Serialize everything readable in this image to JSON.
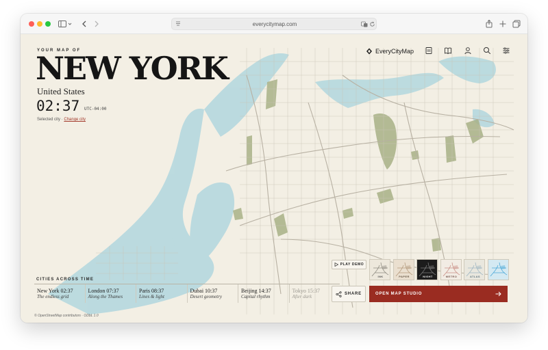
{
  "browser": {
    "url": "everycitymap.com"
  },
  "hero": {
    "eyebrow": "YOUR MAP OF",
    "city": "NEW YORK",
    "country": "United States",
    "time": "02:37",
    "timezone": "UTC-04:00",
    "selected_prefix": "Selected city ·",
    "change_city": "Change city"
  },
  "nav": {
    "brand": "EveryCityMap"
  },
  "cities_section": {
    "label": "CITIES ACROSS TIME",
    "items": [
      {
        "name": "New York 02:37",
        "desc": "The endless grid"
      },
      {
        "name": "London 07:37",
        "desc": "Along the Thames"
      },
      {
        "name": "Paris 08:37",
        "desc": "Lines & light"
      },
      {
        "name": "Dubai 10:37",
        "desc": "Desert geometry"
      },
      {
        "name": "Beijing 14:37",
        "desc": "Capital rhythm"
      },
      {
        "name": "Tokyo 15:37",
        "desc": "After dark"
      }
    ]
  },
  "actions": {
    "share": "SHARE",
    "open_studio": "OPEN MAP STUDIO",
    "play_demo": "PLAY DEMO"
  },
  "styles": [
    {
      "label": "INK",
      "bg": "#ede8dc",
      "accent": "#8d8a80",
      "text": "#555555"
    },
    {
      "label": "PAPER",
      "bg": "#eadfcf",
      "accent": "#b49a7c",
      "text": "#6a5a48"
    },
    {
      "label": "NIGHT",
      "bg": "#1c1c1c",
      "accent": "#7b7b7b",
      "text": "#eeeeee"
    },
    {
      "label": "METRO",
      "bg": "#f2ece4",
      "accent": "#c98f86",
      "text": "#7b5a52"
    },
    {
      "label": "ATLAS",
      "bg": "#e9e7de",
      "accent": "#9eb6c2",
      "text": "#5e7480"
    },
    {
      "label": "",
      "bg": "#d4e9f2",
      "accent": "#4aa8d8",
      "text": "#2f6f92"
    }
  ],
  "credits": "© OpenStreetMap contributors · ODbL 1.0",
  "colors": {
    "accent": "#9a2c21",
    "water": "#a9d4de",
    "park": "#a8b187",
    "road": "#b7b0a2",
    "paper": "#f3efe4"
  }
}
